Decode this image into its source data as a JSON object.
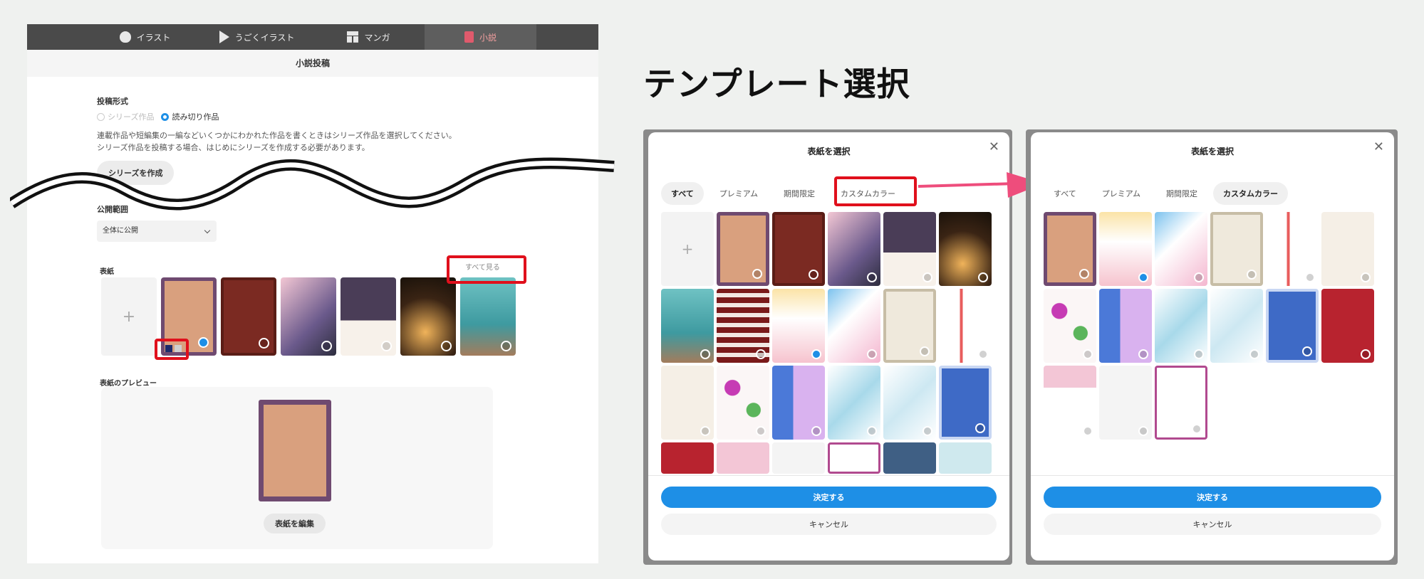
{
  "tabs": [
    {
      "label": "イラスト",
      "icon": "apple-icon"
    },
    {
      "label": "うごくイラスト",
      "icon": "play-icon"
    },
    {
      "label": "マンガ",
      "icon": "grid-icon"
    },
    {
      "label": "小説",
      "icon": "book-icon"
    }
  ],
  "page_title": "小説投稿",
  "post_type": {
    "label": "投稿形式",
    "options": [
      "シリーズ作品",
      "読み切り作品"
    ],
    "selected": "読み切り作品"
  },
  "note_line1": "連載作品や短編集の一編などいくつかにわかれた作品を書くときはシリーズ作品を選択してください。",
  "note_line2": "シリーズ作品を投稿する場合、はじめにシリーズを作成する必要があります。",
  "create_series_button": "シリーズを作成",
  "scope": {
    "label": "公開範囲",
    "value": "全体に公開"
  },
  "cover": {
    "label": "表紙",
    "see_all": "すべて見る"
  },
  "preview_label": "表紙のプレビュー",
  "edit_cover_button": "表紙を編集",
  "heading": "テンプレート選択",
  "modal_left": {
    "title": "表紙を選択",
    "filters": [
      "すべて",
      "プレミアム",
      "期間限定",
      "カスタムカラー"
    ],
    "selected_filter": "すべて",
    "ok": "決定する",
    "cancel": "キャンセル"
  },
  "modal_right": {
    "title": "表紙を選択",
    "filters": [
      "すべて",
      "プレミアム",
      "期間限定",
      "カスタムカラー"
    ],
    "selected_filter": "カスタムカラー",
    "ok": "決定する",
    "cancel": "キャンセル"
  },
  "colors": {
    "accent": "#1e8fe6",
    "highlight_red": "#e0101c",
    "arrow_pink": "#ee4d7c"
  }
}
